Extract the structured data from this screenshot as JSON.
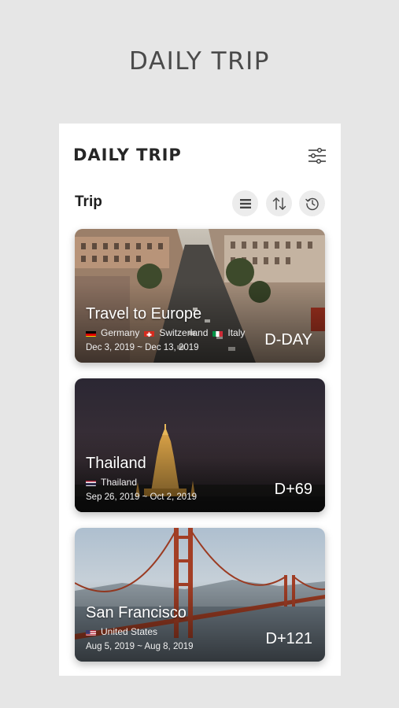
{
  "promo": {
    "title": "DAILY TRIP"
  },
  "app": {
    "title": "DAILY TRIP",
    "filter_icon": "sliders-icon"
  },
  "section": {
    "title": "Trip",
    "actions": [
      {
        "icon": "list-icon"
      },
      {
        "icon": "sort-icon"
      },
      {
        "icon": "history-icon"
      }
    ]
  },
  "trips": [
    {
      "name": "Travel to Europe",
      "countries": [
        {
          "name": "Germany",
          "flag": "de"
        },
        {
          "name": "Switzerland",
          "flag": "ch"
        },
        {
          "name": "Italy",
          "flag": "it"
        }
      ],
      "dates": "Dec 3, 2019 ~ Dec 13, 2019",
      "dday": "D-DAY"
    },
    {
      "name": "Thailand",
      "countries": [
        {
          "name": "Thailand",
          "flag": "th"
        }
      ],
      "dates": "Sep 26, 2019 ~ Oct 2, 2019",
      "dday": "D+69"
    },
    {
      "name": "San Francisco",
      "countries": [
        {
          "name": "United States",
          "flag": "us"
        }
      ],
      "dates": "Aug 5, 2019 ~ Aug 8, 2019",
      "dday": "D+121"
    }
  ]
}
